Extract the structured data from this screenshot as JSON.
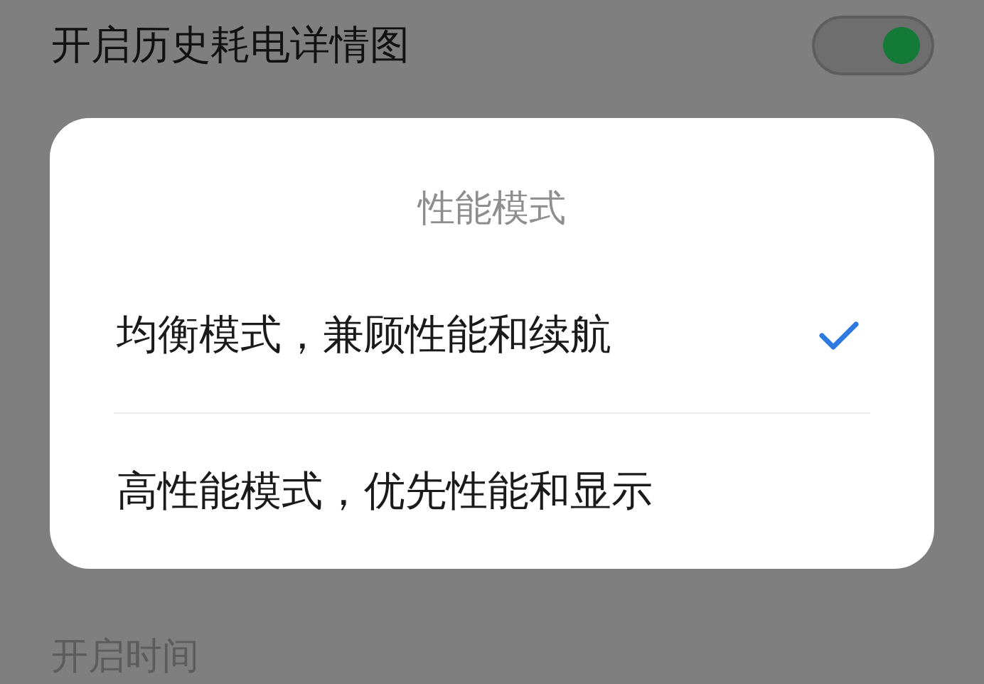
{
  "settings_row": {
    "label": "开启历史耗电详情图",
    "on": true
  },
  "dialog": {
    "title": "性能模式",
    "options": [
      {
        "label": "均衡模式，兼顾性能和续航",
        "selected": true
      },
      {
        "label": "高性能模式，优先性能和显示",
        "selected": false
      }
    ]
  },
  "section_header": "开启时间"
}
